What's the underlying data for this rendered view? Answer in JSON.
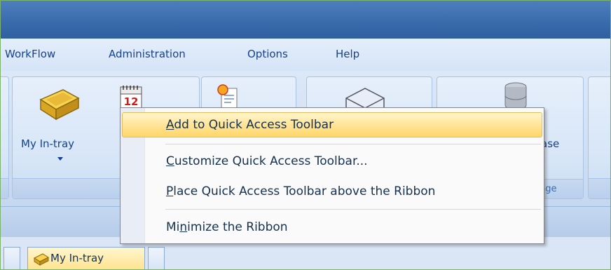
{
  "menubar": {
    "items": [
      "WorkFlow",
      "Administration",
      "Options",
      "Help"
    ]
  },
  "ribbon": {
    "my_intray_label": "My In-tray",
    "database_label_partial": "ase",
    "manage_caption_partial": "nge"
  },
  "tabs": {
    "my_intray": "My In-tray"
  },
  "context_menu": {
    "items": [
      {
        "label": "Add to Quick Access Toolbar",
        "underline": "A",
        "highlighted": true
      },
      {
        "label": "Customize Quick Access Toolbar...",
        "underline": "C",
        "highlighted": false
      },
      {
        "label": "Place Quick Access Toolbar above the Ribbon",
        "underline": "P",
        "highlighted": false
      },
      {
        "label": "Minimize the Ribbon",
        "underline": "n",
        "highlighted": false
      }
    ]
  },
  "colors": {
    "title_blue": "#3a6cad",
    "menu_text": "#15428b",
    "highlight": "#ffe59a"
  },
  "calendar_icon_day": "12"
}
